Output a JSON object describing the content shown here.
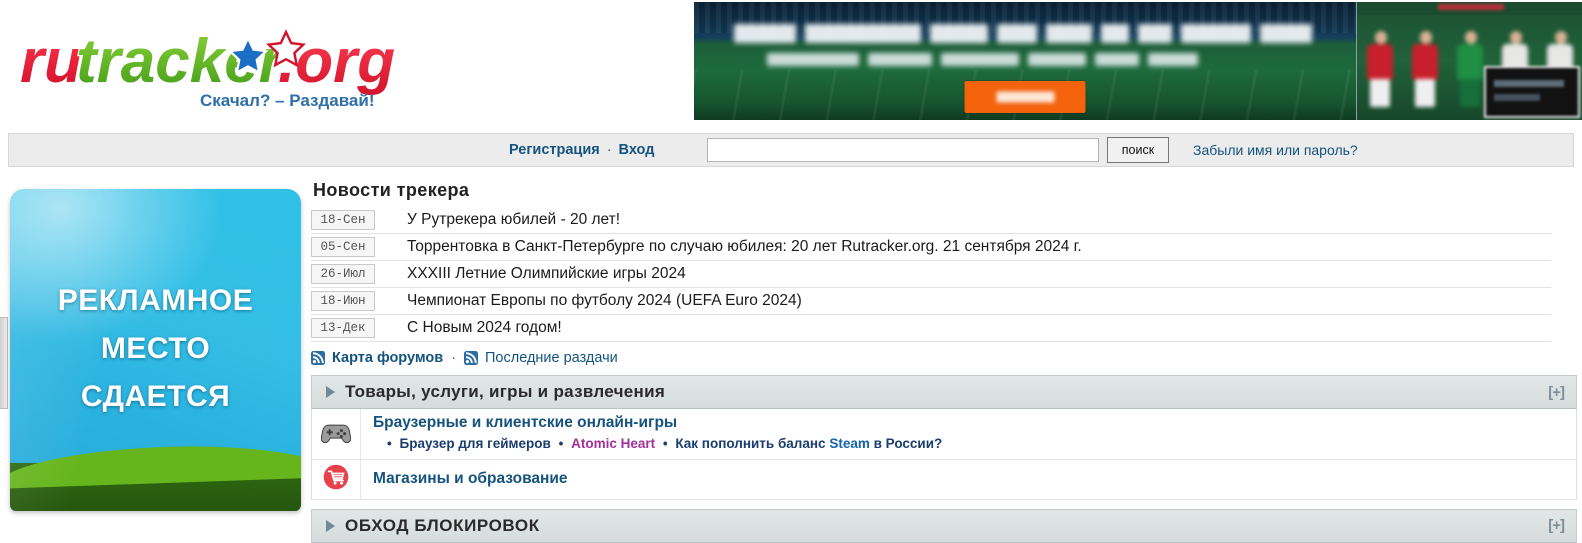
{
  "site": {
    "logo_text": "rutracker.org",
    "logo_parts": {
      "ru": "ru",
      "tracker": "tracker",
      "dot": ".",
      "org": "org"
    },
    "tagline": "Скачал? – Раздавай!"
  },
  "nav": {
    "register_label": "Регистрация",
    "separator": "·",
    "login_label": "Вход",
    "search_value": "",
    "search_placeholder": "",
    "search_button_label": "поиск",
    "forgot_label": "Забыли имя или пароль?"
  },
  "left_ad": {
    "line1": "РЕКЛАМНОЕ",
    "line2": "МЕСТО",
    "line3": "СДАЕТСЯ"
  },
  "news": {
    "title": "Новости трекера",
    "items": [
      {
        "date": "18-Сен",
        "text": "У Рутрекера юбилей - 20 лет!"
      },
      {
        "date": "05-Сен",
        "text": "Торрентовка в Санкт-Петербурге по случаю юбилея: 20 лет Rutracker.org. 21 сентября 2024 г."
      },
      {
        "date": "26-Июл",
        "text": "XXXIII Летние Олимпийские игры 2024"
      },
      {
        "date": "18-Июн",
        "text": "Чемпионат Европы по футболу 2024 (UEFA Euro 2024)"
      },
      {
        "date": "13-Дек",
        "text": "С Новым 2024 годом!"
      }
    ],
    "rss": {
      "map_label": "Карта форумов",
      "separator": "·",
      "latest_label": "Последние раздачи",
      "icon_map": "rss-icon",
      "icon_latest": "rss-icon"
    }
  },
  "categories": [
    {
      "title": "Товары, услуги, игры и развлечения",
      "collapse_label": "[+]",
      "arrow_icon": "triangle-right-icon",
      "forums": [
        {
          "icon": "gamepad-icon",
          "title": "Браузерные и клиентские онлайн-игры",
          "sub_links": [
            {
              "text": "Браузер для геймеров",
              "color": "#1b3d6d"
            },
            {
              "text": "Atomic Heart",
              "color": "#a4309c"
            },
            {
              "text": "Как пополнить баланс Steam в России?",
              "color": "#1b3d6d",
              "highlight": "Steam",
              "highlight_color": "#1463ad"
            }
          ],
          "bullet": "•"
        },
        {
          "icon": "shopping-cart-icon",
          "title": "Магазины и образование",
          "sub_links": [],
          "bullet": "•"
        }
      ]
    },
    {
      "title": "ОБХОД БЛОКИРОВОК",
      "collapse_label": "[+]",
      "arrow_icon": "triangle-right-icon",
      "forums": []
    }
  ],
  "colors": {
    "link_blue": "#15537f",
    "sub_link_blue": "#1b3d6d",
    "magenta": "#a4309c",
    "cta_orange": "#f4630c",
    "cart_red": "#e8414b",
    "ad_cyan": "#2fc0e8",
    "cat_header_bg": "#dde2e2"
  }
}
